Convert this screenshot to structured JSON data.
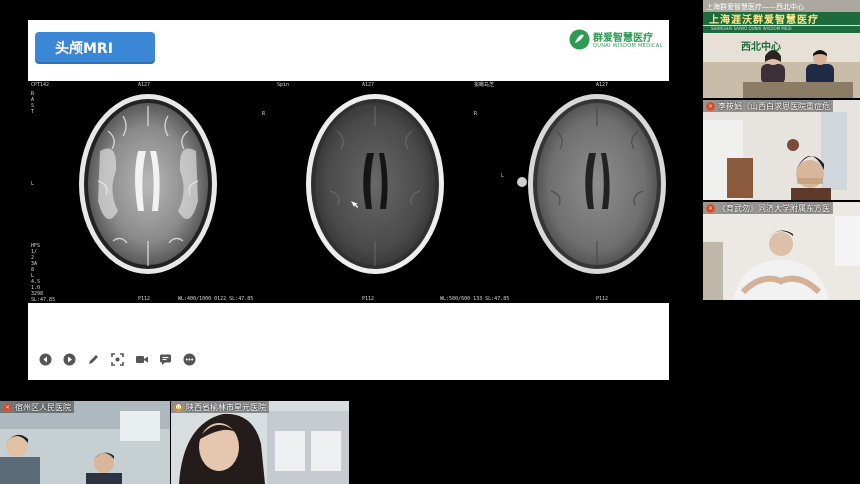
{
  "slide": {
    "title": "头颅MRI",
    "brand": {
      "name_cn": "群爱智慧医疗",
      "name_en": "QUNAI WISDOM MEDICAL",
      "color": "#2f9a52"
    }
  },
  "scans": [
    {
      "top_labels": [
        "CPT142",
        "A127"
      ],
      "left_labels": [
        "R",
        "A",
        "S",
        "T"
      ],
      "mid_left": "L",
      "bottom_left": "HFS\n1/\n2\n3A\n8\nL\n4.S\n1.0\n3298\nSL:47.85",
      "bottom_center": "P112",
      "bottom_right": "WL:400/1000 0122 SL:47.85"
    },
    {
      "top_labels": [
        "Spin",
        "A127"
      ],
      "left_labels": [
        "R"
      ],
      "mid_left": "",
      "bottom_left": "",
      "bottom_center": "P112",
      "bottom_right": "WL:500/600 133 SL:47.85"
    },
    {
      "top_labels": [
        "拔瞰岛芝",
        "A127"
      ],
      "left_labels": [
        "R",
        "L"
      ],
      "mid_left": "",
      "bottom_left": "",
      "bottom_center": "P112",
      "bottom_right": ""
    }
  ],
  "toolbar": {
    "icons": [
      "prev-icon",
      "play-icon",
      "pen-icon",
      "screenshot-icon",
      "video-icon",
      "chat-icon",
      "more-icon"
    ]
  },
  "participants": {
    "hq": {
      "top_text": "上海群爱智慧医疗——西北中心",
      "banner": "上海涯沃群爱智慧医疗",
      "banner_en": "SHANGHAI SAIWO QUNAI WISDOM MEDI",
      "center": "西北中心"
    },
    "tile2": {
      "name": "李筱娟（山西白求恩医院重症危"
    },
    "tile3": {
      "name": "《育武勿》同济大学附属东方医"
    },
    "tile4": {
      "name": "宿州区人民医院"
    },
    "tile5": {
      "name": "陕西省榆林市星元医院"
    }
  }
}
